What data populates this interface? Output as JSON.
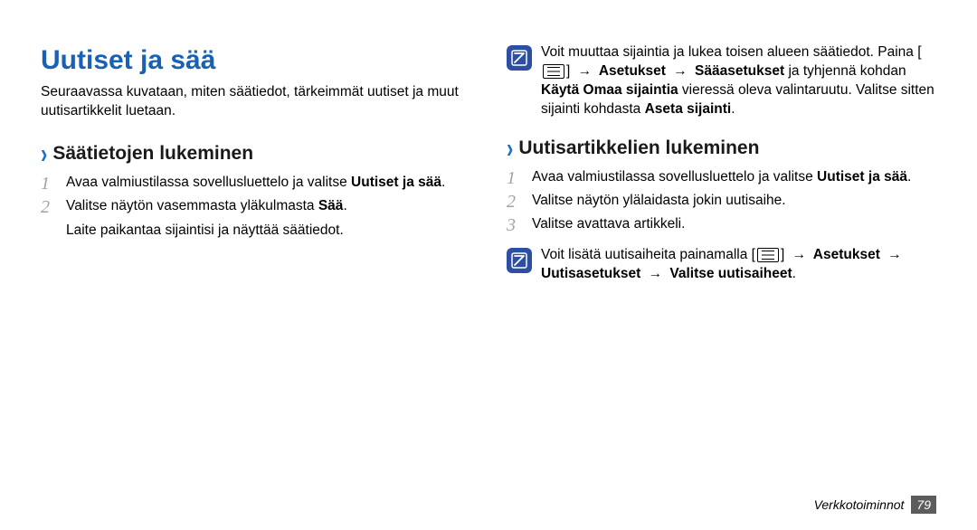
{
  "title": "Uutiset ja sää",
  "intro": "Seuraavassa kuvataan, miten säätiedot, tärkeimmät uutiset ja muut uutisartikkelit luetaan.",
  "left": {
    "heading": "Säätietojen lukeminen",
    "steps": {
      "n1": "1",
      "s1a": "Avaa valmiustilassa sovellusluettelo ja valitse ",
      "s1b": "Uutiset ja sää",
      "s1c": ".",
      "n2": "2",
      "s2a": "Valitse näytön vasemmasta yläkulmasta ",
      "s2b": "Sää",
      "s2c": ".",
      "s2sub": "Laite paikantaa sijaintisi ja näyttää säätiedot."
    }
  },
  "right": {
    "note1": {
      "a": "Voit muuttaa sijaintia ja lukea toisen alueen säätiedot. Paina [",
      "b": "] ",
      "c": " Asetukset ",
      "d": " Sääasetukset",
      "e": " ja tyhjennä kohdan ",
      "f": "Käytä Omaa sijaintia",
      "g": " vieressä oleva valintaruutu. Valitse sitten sijainti kohdasta ",
      "h": "Aseta sijainti",
      "i": "."
    },
    "heading": "Uutisartikkelien lukeminen",
    "steps": {
      "n1": "1",
      "s1a": "Avaa valmiustilassa sovellusluettelo ja valitse ",
      "s1b": "Uutiset ja sää",
      "s1c": ".",
      "n2": "2",
      "s2": "Valitse näytön ylälaidasta jokin uutisaihe.",
      "n3": "3",
      "s3": "Valitse avattava artikkeli."
    },
    "note2": {
      "a": "Voit lisätä uutisaiheita painamalla [",
      "b": "] ",
      "c": " Asetukset ",
      "d": " Uutisasetukset ",
      "e": " Valitse uutisaiheet",
      "f": "."
    }
  },
  "arrow": "→",
  "footer": {
    "section": "Verkkotoiminnot",
    "page": "79"
  }
}
